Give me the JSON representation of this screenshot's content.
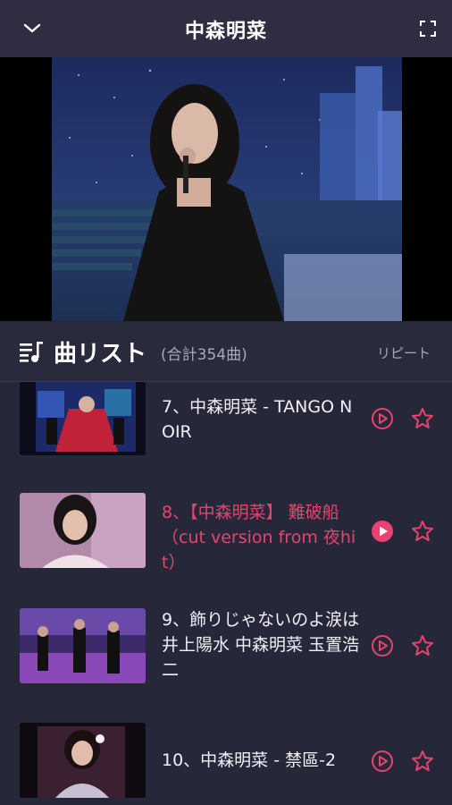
{
  "header": {
    "title": "中森明菜",
    "collapse_icon": "chevron-down-icon",
    "fullscreen_icon": "fullscreen-icon"
  },
  "playlist": {
    "title": "曲リスト",
    "count": "(合計354曲)",
    "repeat_label": "リピート",
    "list_icon": "playlist-icon"
  },
  "songs": [
    {
      "title": "7、中森明菜 - TANGO NOIR",
      "active": false
    },
    {
      "title": "8、【中森明菜】 難破船 （cut version from 夜hit）",
      "active": true
    },
    {
      "title": "9、飾りじゃないのよ涙は 井上陽水 中森明菜 玉置浩二",
      "active": false
    },
    {
      "title": "10、中森明菜 - 禁區-2",
      "active": false
    }
  ],
  "colors": {
    "accent": "#e8436e",
    "background": "#27273a",
    "header_bg": "#2e2d42",
    "text": "#f1f1f5",
    "muted": "#a9a9b8"
  }
}
